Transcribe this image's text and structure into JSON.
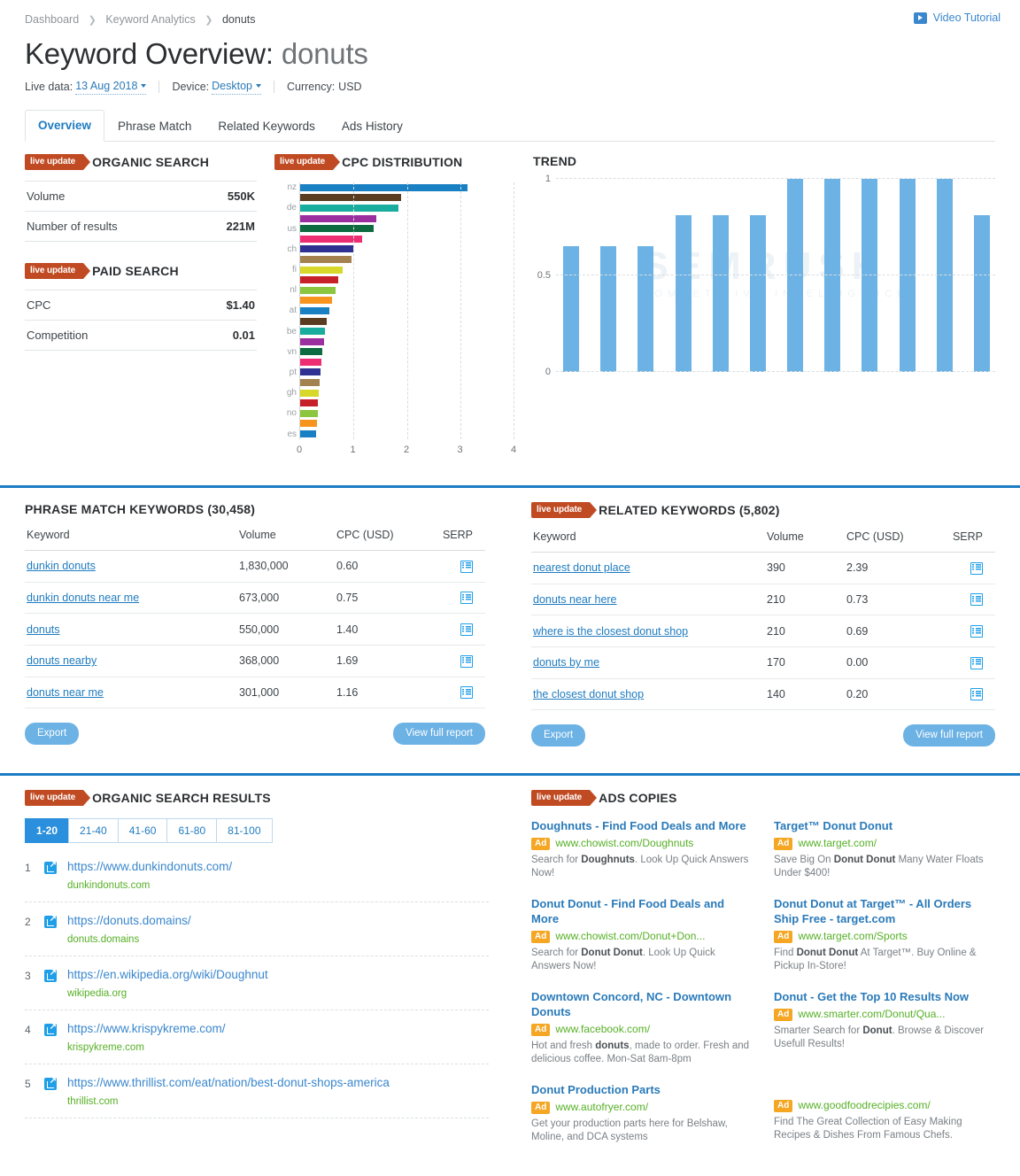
{
  "header": {
    "breadcrumb": [
      {
        "label": "Dashboard",
        "current": false
      },
      {
        "label": "Keyword Analytics",
        "current": false
      },
      {
        "label": "donuts",
        "current": true
      }
    ],
    "video_tutorial": "Video Tutorial",
    "title_prefix": "Keyword Overview:",
    "title_keyword": "donuts",
    "meta": {
      "live_data_label": "Live data:",
      "live_data_value": "13 Aug 2018",
      "device_label": "Device:",
      "device_value": "Desktop",
      "currency_label": "Currency:",
      "currency_value": "USD"
    },
    "tabs": [
      {
        "label": "Overview",
        "active": true
      },
      {
        "label": "Phrase Match",
        "active": false
      },
      {
        "label": "Related Keywords",
        "active": false
      },
      {
        "label": "Ads History",
        "active": false
      }
    ]
  },
  "live_badge_label": "live update",
  "organic_search": {
    "title": "ORGANIC SEARCH",
    "rows": [
      {
        "label": "Volume",
        "value": "550K"
      },
      {
        "label": "Number of results",
        "value": "221M"
      }
    ]
  },
  "paid_search": {
    "title": "PAID SEARCH",
    "rows": [
      {
        "label": "CPC",
        "value": "$1.40"
      },
      {
        "label": "Competition",
        "value": "0.01"
      }
    ]
  },
  "cpc_distribution": {
    "title": "CPC DISTRIBUTION"
  },
  "trend": {
    "title": "TREND"
  },
  "watermark": {
    "line1": "SEMRUSH",
    "line2": "COMPETITIVE INTELLIGENCE"
  },
  "phrase_match": {
    "title": "PHRASE MATCH KEYWORDS (30,458)",
    "columns": [
      "Keyword",
      "Volume",
      "CPC (USD)",
      "SERP"
    ],
    "rows": [
      {
        "keyword": "dunkin donuts",
        "volume": "1,830,000",
        "cpc": "0.60",
        "serp": "serp-icon"
      },
      {
        "keyword": "dunkin donuts near me",
        "volume": "673,000",
        "cpc": "0.75",
        "serp": "serp-icon"
      },
      {
        "keyword": "donuts",
        "volume": "550,000",
        "cpc": "1.40",
        "serp": "serp-icon"
      },
      {
        "keyword": "donuts nearby",
        "volume": "368,000",
        "cpc": "1.69",
        "serp": "serp-icon"
      },
      {
        "keyword": "donuts near me",
        "volume": "301,000",
        "cpc": "1.16",
        "serp": "serp-icon"
      }
    ],
    "export_label": "Export",
    "view_report_label": "View full report"
  },
  "related_keywords": {
    "title": "RELATED KEYWORDS (5,802)",
    "columns": [
      "Keyword",
      "Volume",
      "CPC (USD)",
      "SERP"
    ],
    "rows": [
      {
        "keyword": "nearest donut place",
        "volume": "390",
        "cpc": "2.39",
        "serp": "serp-icon"
      },
      {
        "keyword": "donuts near here",
        "volume": "210",
        "cpc": "0.73",
        "serp": "serp-icon"
      },
      {
        "keyword": "where is the closest donut shop",
        "volume": "210",
        "cpc": "0.69",
        "serp": "serp-icon"
      },
      {
        "keyword": "donuts by me",
        "volume": "170",
        "cpc": "0.00",
        "serp": "serp-icon"
      },
      {
        "keyword": "the closest donut shop",
        "volume": "140",
        "cpc": "0.20",
        "serp": "serp-icon"
      }
    ],
    "export_label": "Export",
    "view_report_label": "View full report"
  },
  "organic_results": {
    "title": "ORGANIC SEARCH RESULTS",
    "pages": [
      {
        "label": "1-20",
        "active": true
      },
      {
        "label": "21-40",
        "active": false
      },
      {
        "label": "41-60",
        "active": false
      },
      {
        "label": "61-80",
        "active": false
      },
      {
        "label": "81-100",
        "active": false
      }
    ],
    "items": [
      {
        "num": "1",
        "url": "https://www.dunkindonuts.com/",
        "domain": "dunkindonuts.com"
      },
      {
        "num": "2",
        "url": "https://donuts.domains/",
        "domain": "donuts.domains"
      },
      {
        "num": "3",
        "url": "https://en.wikipedia.org/wiki/Doughnut",
        "domain": "wikipedia.org"
      },
      {
        "num": "4",
        "url": "https://www.krispykreme.com/",
        "domain": "krispykreme.com"
      },
      {
        "num": "5",
        "url": "https://www.thrillist.com/eat/nation/best-donut-shops-america",
        "domain": "thrillist.com"
      }
    ]
  },
  "ads_copies": {
    "title": "ADS COPIES",
    "ad_badge": "Ad",
    "left": [
      {
        "title": "Doughnuts - Find Food Deals and More",
        "url": "www.chowist.com/Doughnuts",
        "desc_parts": [
          {
            "t": "Search for ",
            "b": false
          },
          {
            "t": "Doughnuts",
            "b": true
          },
          {
            "t": ". Look Up Quick Answers Now!",
            "b": false
          }
        ]
      },
      {
        "title": "Donut Donut - Find Food Deals and More",
        "url": "www.chowist.com/Donut+Don...",
        "desc_parts": [
          {
            "t": "Search for ",
            "b": false
          },
          {
            "t": "Donut Donut",
            "b": true
          },
          {
            "t": ". Look Up Quick Answers Now!",
            "b": false
          }
        ]
      },
      {
        "title": "Downtown Concord, NC - Downtown Donuts",
        "url": "www.facebook.com/",
        "desc_parts": [
          {
            "t": "Hot and fresh ",
            "b": false
          },
          {
            "t": "donuts",
            "b": true
          },
          {
            "t": ", made to order. Fresh and delicious coffee. Mon-Sat 8am-8pm",
            "b": false
          }
        ]
      },
      {
        "title": "Donut Production Parts",
        "url": "www.autofryer.com/",
        "desc_parts": [
          {
            "t": "Get your production parts here for Belshaw, Moline, and DCA systems",
            "b": false
          }
        ]
      }
    ],
    "right": [
      {
        "title": "Target™ Donut Donut",
        "url": "www.target.com/",
        "desc_parts": [
          {
            "t": "Save Big On ",
            "b": false
          },
          {
            "t": "Donut Donut",
            "b": true
          },
          {
            "t": " Many Water Floats Under $400!",
            "b": false
          }
        ]
      },
      {
        "title": "Donut Donut at Target™ - All Orders Ship Free - target.com",
        "url": "www.target.com/Sports",
        "desc_parts": [
          {
            "t": "Find ",
            "b": false
          },
          {
            "t": "Donut Donut",
            "b": true
          },
          {
            "t": " At Target™. Buy Online & Pickup In-Store!",
            "b": false
          }
        ]
      },
      {
        "title": "Donut - Get the Top 10 Results Now",
        "url": "www.smarter.com/Donut/Qua...",
        "desc_parts": [
          {
            "t": "Smarter Search for ",
            "b": false
          },
          {
            "t": "Donut",
            "b": true
          },
          {
            "t": ". Browse & Discover Usefull Results!",
            "b": false
          }
        ]
      },
      {
        "title": "",
        "url": "www.goodfoodrecipies.com/",
        "desc_parts": [
          {
            "t": "Find The Great Collection of Easy Making Recipes & Dishes From Famous Chefs.",
            "b": false
          }
        ]
      }
    ]
  },
  "colors": {
    "accent_blue": "#1f7cc0",
    "live_badge": "#c04a22",
    "ad_badge": "#f5a623",
    "green_url": "#56b026",
    "trend_bar": "#6cb2e4",
    "divider_blue": "#1c7cc4"
  },
  "chart_data": [
    {
      "type": "bar",
      "orientation": "horizontal",
      "title": "CPC DISTRIBUTION",
      "xlabel": "",
      "ylabel": "",
      "xlim": [
        0,
        4
      ],
      "xticks": [
        "0",
        "1",
        "2",
        "3",
        "4"
      ],
      "grid": true,
      "categories": [
        "nz",
        "",
        "de",
        "",
        "us",
        "",
        "ch",
        "",
        "fi",
        "",
        "nl",
        "",
        "at",
        "",
        "be",
        "",
        "vn",
        "",
        "pt",
        "",
        "gh",
        "",
        "no",
        "",
        "es"
      ],
      "values": [
        3.14,
        1.9,
        1.84,
        1.42,
        1.38,
        1.17,
        1.0,
        0.97,
        0.8,
        0.72,
        0.67,
        0.6,
        0.54,
        0.5,
        0.46,
        0.44,
        0.42,
        0.4,
        0.38,
        0.37,
        0.35,
        0.34,
        0.33,
        0.31,
        0.3
      ],
      "bar_colors": [
        "#1a80c4",
        "#5a3d20",
        "#18ad9e",
        "#9b2fa0",
        "#0d6b3f",
        "#ee2e72",
        "#2e3192",
        "#a3824f",
        "#d7d82a",
        "#c62128",
        "#8cc63f",
        "#f7941e",
        "#1a80c4",
        "#5a3d20",
        "#18ad9e",
        "#9b2fa0",
        "#0d6b3f",
        "#ee2e72",
        "#2e3192",
        "#a3824f",
        "#d7d82a",
        "#c62128",
        "#8cc63f",
        "#f7941e",
        "#1a80c4"
      ]
    },
    {
      "type": "bar",
      "orientation": "vertical",
      "title": "TREND",
      "xlabel": "",
      "ylabel": "",
      "ylim": [
        0,
        1
      ],
      "yticks": [
        "0",
        "0.5",
        "1"
      ],
      "grid": true,
      "categories": [
        "",
        "",
        "",
        "",
        "",
        "",
        "",
        "",
        "",
        "",
        "",
        ""
      ],
      "values": [
        0.65,
        0.65,
        0.65,
        0.81,
        0.81,
        0.81,
        1.0,
        1.0,
        1.0,
        1.0,
        1.0,
        0.81
      ],
      "bar_color": "#6cb2e4"
    }
  ]
}
